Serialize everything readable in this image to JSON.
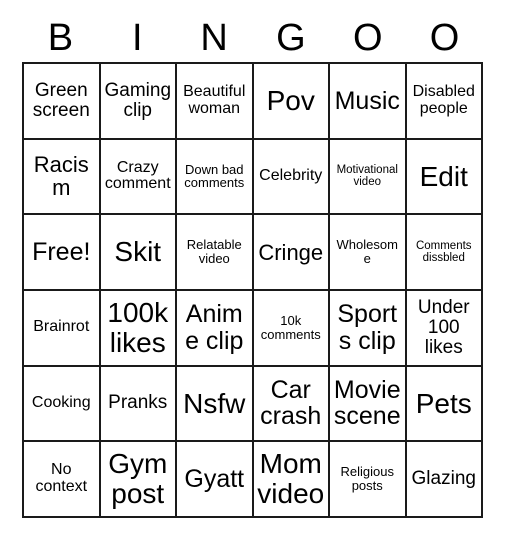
{
  "card": {
    "title_letters": [
      "B",
      "I",
      "N",
      "G",
      "O",
      "O"
    ],
    "columns": 6,
    "rows": 6,
    "colors": {
      "background": "#ffffff",
      "grid_line": "#1a1a1a",
      "text": "#000000"
    },
    "free_space": "Free!",
    "cells": [
      [
        {
          "text": "Green screen",
          "size": "md"
        },
        {
          "text": "Gaming clip",
          "size": "md"
        },
        {
          "text": "Beautiful woman",
          "size": "sm"
        },
        {
          "text": "Pov",
          "size": "xxl"
        },
        {
          "text": "Music",
          "size": "xl"
        },
        {
          "text": "Disabled people",
          "size": "sm"
        }
      ],
      [
        {
          "text": "Racism",
          "size": "lg"
        },
        {
          "text": "Crazy comment",
          "size": "sm"
        },
        {
          "text": "Down bad comments",
          "size": "xs"
        },
        {
          "text": "Celebrity",
          "size": "sm"
        },
        {
          "text": "Motivational video",
          "size": "xxs"
        },
        {
          "text": "Edit",
          "size": "xxl"
        }
      ],
      [
        {
          "text": "Free!",
          "size": "xl"
        },
        {
          "text": "Skit",
          "size": "xxl"
        },
        {
          "text": "Relatable video",
          "size": "xs"
        },
        {
          "text": "Cringe",
          "size": "lg"
        },
        {
          "text": "Wholesome",
          "size": "xs"
        },
        {
          "text": "Comments dissbled",
          "size": "xxs"
        }
      ],
      [
        {
          "text": "Brainrot",
          "size": "sm"
        },
        {
          "text": "100k likes",
          "size": "xxl"
        },
        {
          "text": "Anime clip",
          "size": "xl"
        },
        {
          "text": "10k comments",
          "size": "xs"
        },
        {
          "text": "Sports clip",
          "size": "xl"
        },
        {
          "text": "Under 100 likes",
          "size": "md"
        }
      ],
      [
        {
          "text": "Cooking",
          "size": "sm"
        },
        {
          "text": "Pranks",
          "size": "md"
        },
        {
          "text": "Nsfw",
          "size": "xxl"
        },
        {
          "text": "Car crash",
          "size": "xl"
        },
        {
          "text": "Movie scene",
          "size": "xl"
        },
        {
          "text": "Pets",
          "size": "xxl"
        }
      ],
      [
        {
          "text": "No context",
          "size": "sm"
        },
        {
          "text": "Gym post",
          "size": "xxl"
        },
        {
          "text": "Gyatt",
          "size": "xl"
        },
        {
          "text": "Mom video",
          "size": "xxl"
        },
        {
          "text": "Religious posts",
          "size": "xs"
        },
        {
          "text": "Glazing",
          "size": "md"
        }
      ]
    ]
  }
}
